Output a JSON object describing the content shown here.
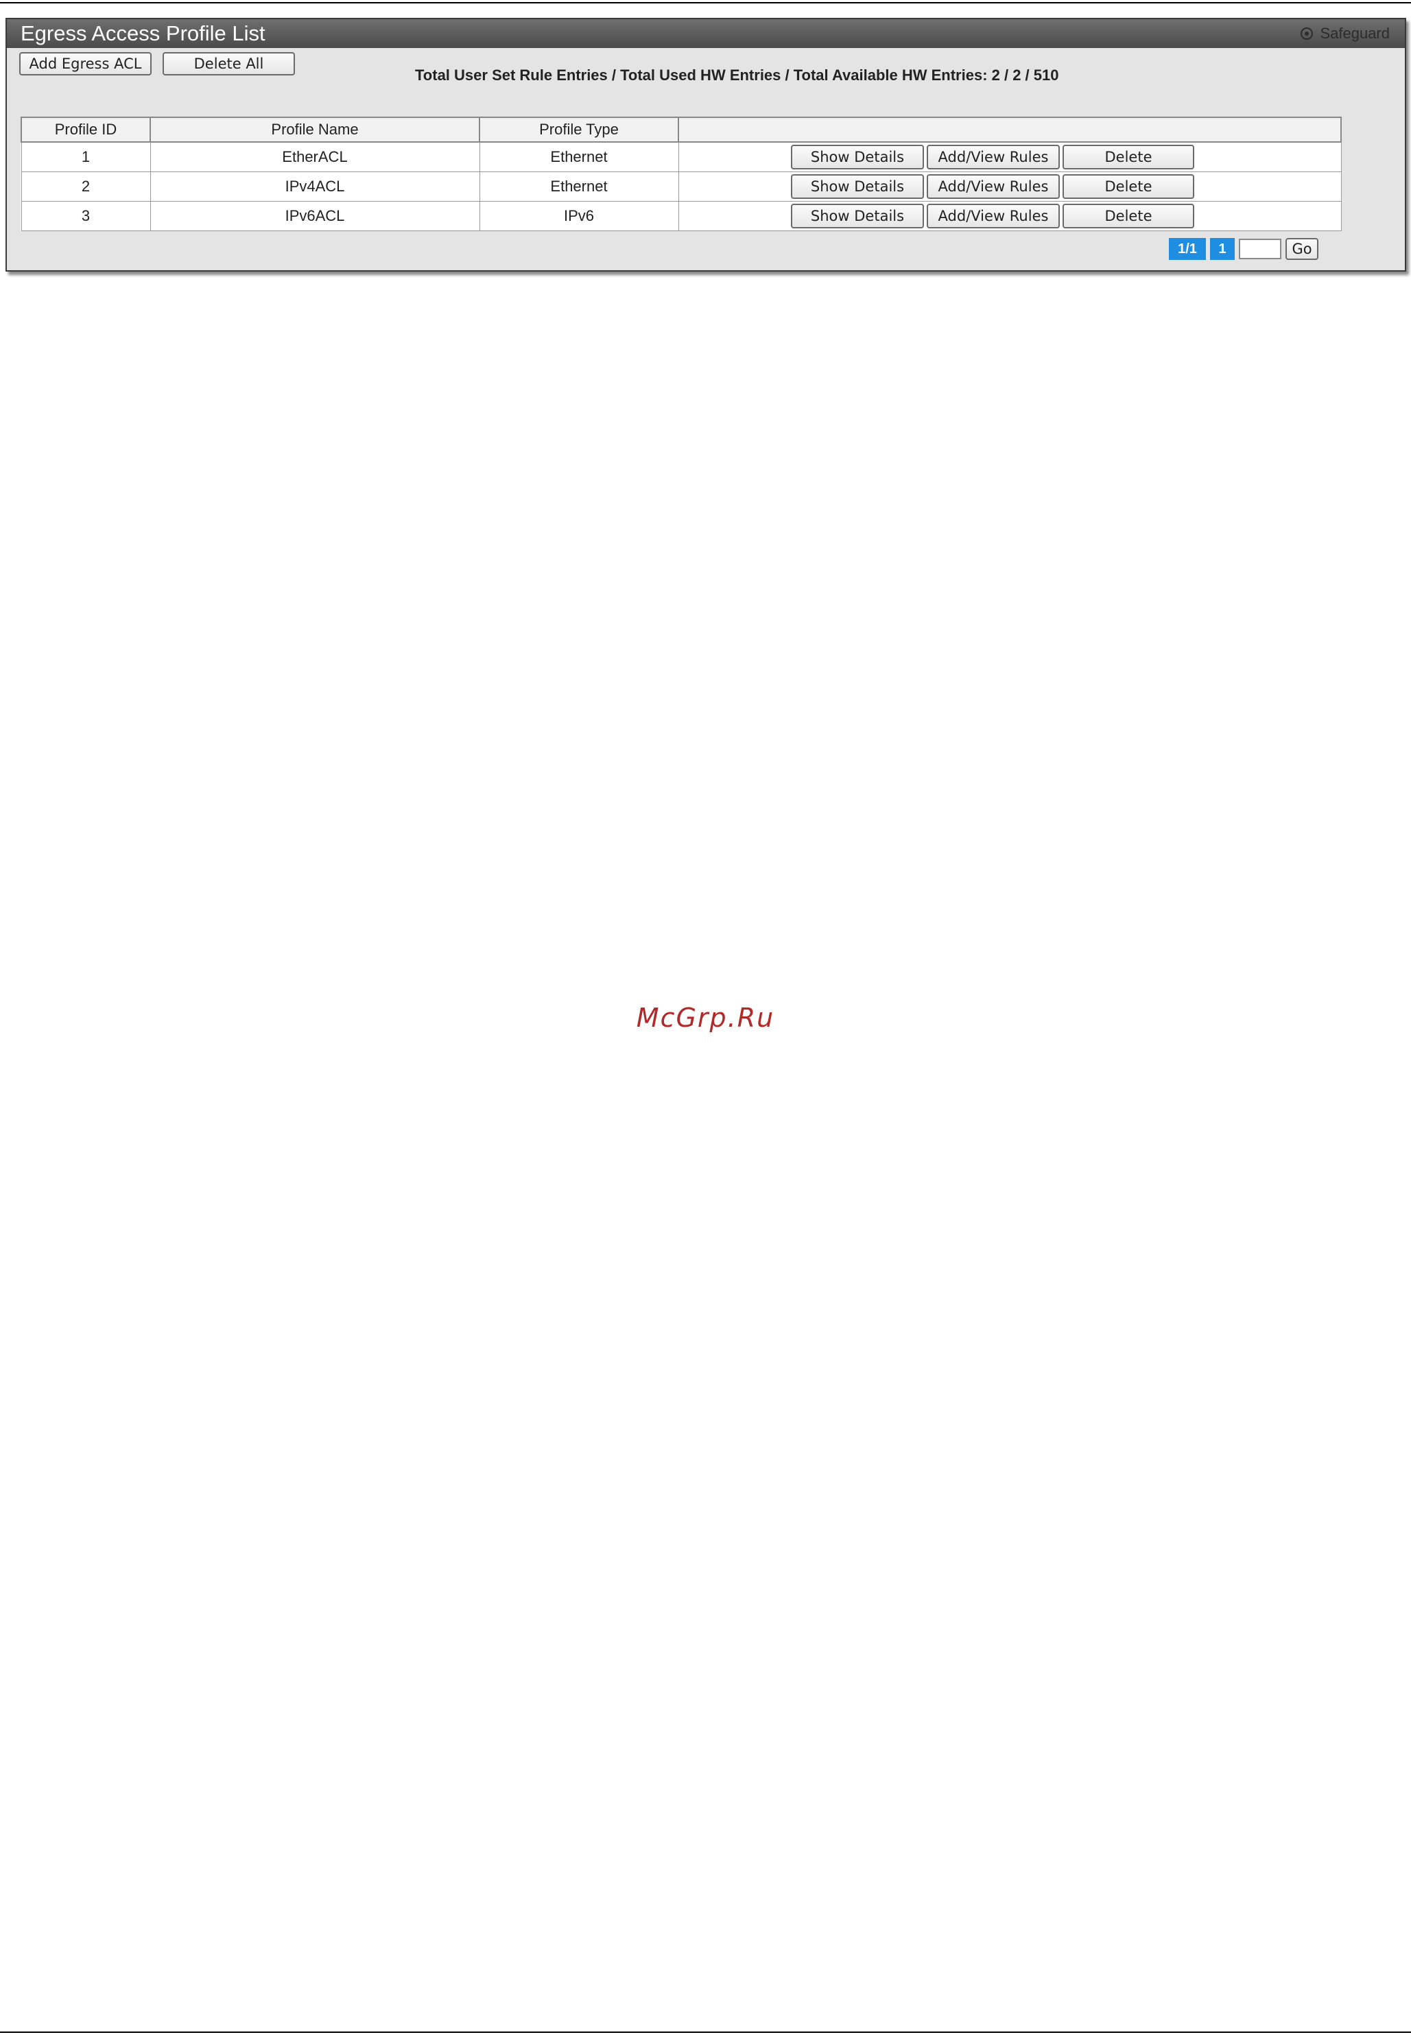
{
  "window": {
    "title": "Egress Access Profile List",
    "safeguard_label": "Safeguard"
  },
  "toolbar": {
    "add_label": "Add Egress ACL",
    "delete_all_label": "Delete All",
    "totals_text": "Total User Set Rule Entries / Total Used HW Entries / Total Available HW Entries: 2 / 2 / 510"
  },
  "table": {
    "headers": [
      "Profile ID",
      "Profile Name",
      "Profile Type",
      ""
    ],
    "rows": [
      {
        "id": "1",
        "name": "EtherACL",
        "type": "Ethernet"
      },
      {
        "id": "2",
        "name": "IPv4ACL",
        "type": "Ethernet"
      },
      {
        "id": "3",
        "name": "IPv6ACL",
        "type": "IPv6"
      }
    ],
    "actions": {
      "show": "Show Details",
      "add": "Add/View Rules",
      "delete": "Delete"
    }
  },
  "pager": {
    "total": "1/1",
    "current": "1",
    "input_value": "",
    "go_label": "Go"
  },
  "watermark": "McGrp.Ru",
  "colors": {
    "titlebar": "#5a5a5a",
    "pager_badge": "#1f8ee0",
    "watermark": "#b02a2a",
    "panel": "#e4e4e4"
  }
}
